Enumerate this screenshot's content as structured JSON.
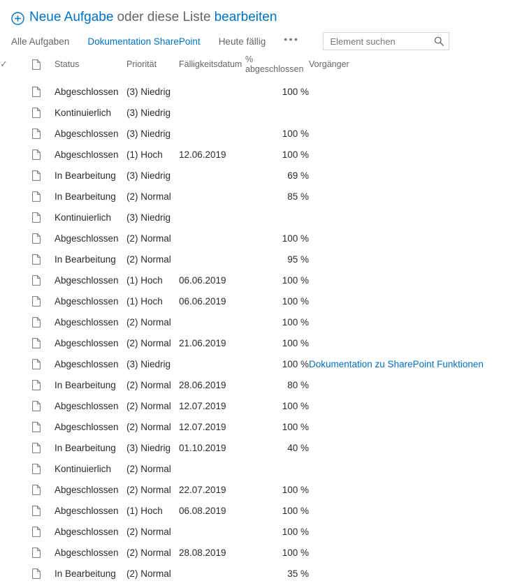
{
  "command_bar": {
    "plus_icon": "plus-circle-icon",
    "new_task_label": "Neue Aufgabe",
    "separator_label": "oder diese Liste",
    "edit_label": "bearbeiten"
  },
  "views": {
    "tabs": [
      {
        "label": "Alle Aufgaben",
        "active": false
      },
      {
        "label": "Dokumentation SharePoint",
        "active": true
      },
      {
        "label": "Heute fällig",
        "active": false
      }
    ],
    "overflow_label": "•••",
    "search": {
      "placeholder": "Element suchen",
      "value": "",
      "icon": "search-icon"
    }
  },
  "table": {
    "columns": [
      {
        "key": "check",
        "label": "✓",
        "icon": "checkmark-icon"
      },
      {
        "key": "doc",
        "label": "",
        "icon": "document-icon"
      },
      {
        "key": "status",
        "label": "Status"
      },
      {
        "key": "prio",
        "label": "Priorität"
      },
      {
        "key": "due",
        "label": "Fälligkeitsdatum"
      },
      {
        "key": "pct",
        "label": "% abgeschlossen"
      },
      {
        "key": "pred",
        "label": "Vorgänger"
      }
    ],
    "rows": [
      {
        "status": "Abgeschlossen",
        "prio": "(3) Niedrig",
        "due": "",
        "pct": "100 %",
        "pred": ""
      },
      {
        "status": "Kontinuierlich",
        "prio": "(3) Niedrig",
        "due": "",
        "pct": "",
        "pred": ""
      },
      {
        "status": "Abgeschlossen",
        "prio": "(3) Niedrig",
        "due": "",
        "pct": "100 %",
        "pred": ""
      },
      {
        "status": "Abgeschlossen",
        "prio": "(1) Hoch",
        "due": "12.06.2019",
        "pct": "100 %",
        "pred": ""
      },
      {
        "status": "In Bearbeitung",
        "prio": "(3) Niedrig",
        "due": "",
        "pct": "69 %",
        "pred": ""
      },
      {
        "status": "In Bearbeitung",
        "prio": "(2) Normal",
        "due": "",
        "pct": "85 %",
        "pred": ""
      },
      {
        "status": "Kontinuierlich",
        "prio": "(3) Niedrig",
        "due": "",
        "pct": "",
        "pred": ""
      },
      {
        "status": "Abgeschlossen",
        "prio": "(2) Normal",
        "due": "",
        "pct": "100 %",
        "pred": ""
      },
      {
        "status": "In Bearbeitung",
        "prio": "(2) Normal",
        "due": "",
        "pct": "95 %",
        "pred": ""
      },
      {
        "status": "Abgeschlossen",
        "prio": "(1) Hoch",
        "due": "06.06.2019",
        "pct": "100 %",
        "pred": ""
      },
      {
        "status": "Abgeschlossen",
        "prio": "(1) Hoch",
        "due": "06.06.2019",
        "pct": "100 %",
        "pred": ""
      },
      {
        "status": "Abgeschlossen",
        "prio": "(2) Normal",
        "due": "",
        "pct": "100 %",
        "pred": ""
      },
      {
        "status": "Abgeschlossen",
        "prio": "(2) Normal",
        "due": "21.06.2019",
        "pct": "100 %",
        "pred": ""
      },
      {
        "status": "Abgeschlossen",
        "prio": "(3) Niedrig",
        "due": "",
        "pct": "100 %",
        "pred": "Dokumentation zu SharePoint Funktionen"
      },
      {
        "status": "In Bearbeitung",
        "prio": "(2) Normal",
        "due": "28.06.2019",
        "pct": "80 %",
        "pred": ""
      },
      {
        "status": "Abgeschlossen",
        "prio": "(2) Normal",
        "due": "12.07.2019",
        "pct": "100 %",
        "pred": ""
      },
      {
        "status": "Abgeschlossen",
        "prio": "(2) Normal",
        "due": "12.07.2019",
        "pct": "100 %",
        "pred": ""
      },
      {
        "status": "In Bearbeitung",
        "prio": "(3) Niedrig",
        "due": "01.10.2019",
        "pct": "40 %",
        "pred": ""
      },
      {
        "status": "Kontinuierlich",
        "prio": "(2) Normal",
        "due": "",
        "pct": "",
        "pred": ""
      },
      {
        "status": "Abgeschlossen",
        "prio": "(2) Normal",
        "due": "22.07.2019",
        "pct": "100 %",
        "pred": ""
      },
      {
        "status": "Abgeschlossen",
        "prio": "(1) Hoch",
        "due": "06.08.2019",
        "pct": "100 %",
        "pred": ""
      },
      {
        "status": "Abgeschlossen",
        "prio": "(2) Normal",
        "due": "",
        "pct": "100 %",
        "pred": ""
      },
      {
        "status": "Abgeschlossen",
        "prio": "(2) Normal",
        "due": "28.08.2019",
        "pct": "100 %",
        "pred": ""
      },
      {
        "status": "In Bearbeitung",
        "prio": "(2) Normal",
        "due": "",
        "pct": "35 %",
        "pred": ""
      }
    ]
  },
  "colors": {
    "link_blue": "#0072c6",
    "text_gray": "#666666",
    "body_text": "#2b2b2b",
    "border_gray": "#d6d6d6"
  }
}
